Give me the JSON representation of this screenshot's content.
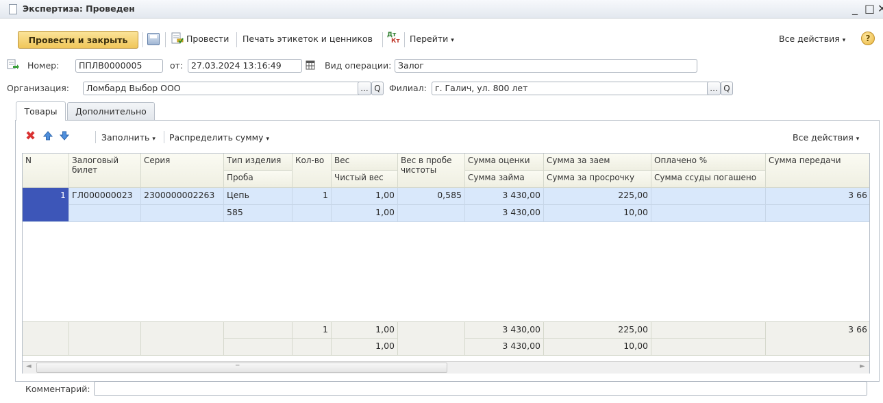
{
  "window": {
    "title": "Экспертиза: Проведен",
    "controls": {
      "minimize": "_",
      "maximize": "□",
      "close": "✕"
    }
  },
  "toolbar": {
    "post_close": "Провести и закрыть",
    "post": "Провести",
    "print_labels": "Печать этикеток и ценников",
    "goto": "Перейти",
    "all_actions": "Все действия",
    "help": "?",
    "dtkt_top": "Дт",
    "dtkt_bottom": "Кт"
  },
  "header": {
    "number_label": "Номер:",
    "number": "ППЛВ0000005",
    "date_label": "от:",
    "date": "27.03.2024 13:16:49",
    "op_type_label": "Вид операции:",
    "op_type": "Залог",
    "org_label": "Организация:",
    "org": "Ломбард Выбор ООО",
    "branch_label": "Филиал:",
    "branch": "г. Галич, ул. 800 лет",
    "select_btn": "...",
    "search_btn": "Q"
  },
  "tabs": [
    {
      "label": "Товары"
    },
    {
      "label": "Дополнительно"
    }
  ],
  "grid_toolbar": {
    "fill": "Заполнить",
    "distribute": "Распределить сумму",
    "all_actions": "Все действия"
  },
  "grid": {
    "headers": {
      "n": "N",
      "ticket": "Залоговый билет",
      "series": "Серия",
      "item_type": "Тип изделия",
      "probe": "Проба",
      "qty": "Кол-во",
      "weight": "Вес",
      "net_weight": "Чистый вес",
      "pure_weight": "Вес в пробе чистоты",
      "eval_sum": "Сумма оценки",
      "loan_sum": "Сумма займа",
      "loan_fee": "Сумма за заем",
      "overdue_fee": "Сумма за просрочку",
      "paid_pct": "Оплачено %",
      "loan_repaid": "Сумма ссуды погашено",
      "transfer_sum": "Сумма передачи"
    },
    "rows": [
      {
        "n": "1",
        "ticket": "ГЛ000000023",
        "series": "2300000002263",
        "item_type": "Цепь",
        "probe": "585",
        "qty": "1",
        "weight": "1,00",
        "net_weight": "1,00",
        "pure_weight": "0,585",
        "eval_sum": "3 430,00",
        "loan_sum": "3 430,00",
        "loan_fee": "225,00",
        "overdue_fee": "10,00",
        "paid_pct": "",
        "loan_repaid": "",
        "transfer_sum": "3 66"
      }
    ],
    "totals": {
      "qty": "1",
      "weight": "1,00",
      "net_weight": "1,00",
      "eval_sum": "3 430,00",
      "loan_sum": "3 430,00",
      "loan_fee": "225,00",
      "overdue_fee": "10,00",
      "transfer_sum": "3 66"
    }
  },
  "scroll": {
    "left": "◄",
    "right": "►",
    "mark": "═"
  },
  "footer": {
    "comment_label": "Комментарий:",
    "comment": ""
  }
}
